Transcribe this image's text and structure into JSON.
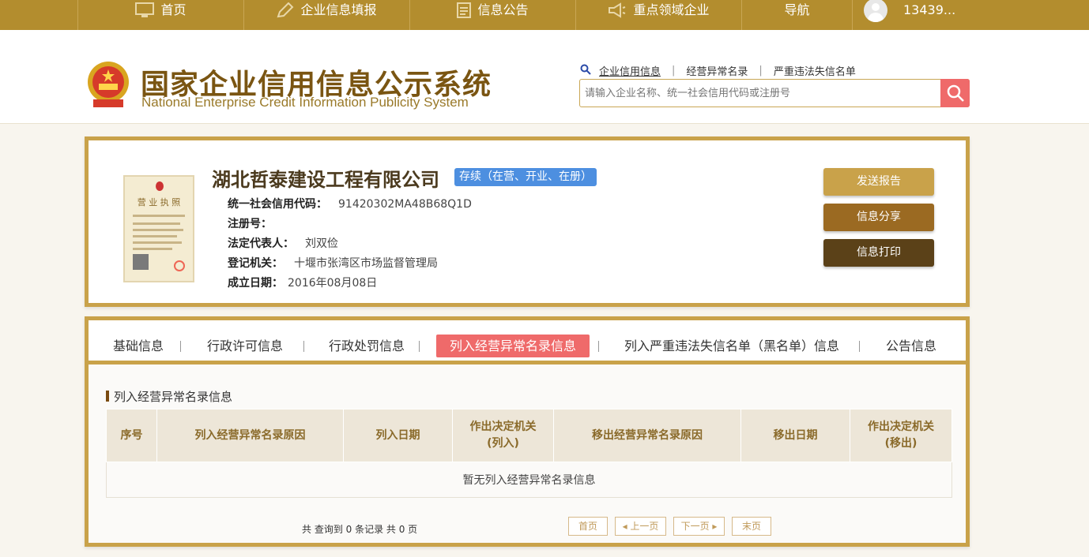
{
  "topnav": {
    "items": [
      {
        "label": "首页",
        "icon": "monitor-icon"
      },
      {
        "label": "企业信息填报",
        "icon": "edit-icon"
      },
      {
        "label": "信息公告",
        "icon": "document-icon"
      },
      {
        "label": "重点领域企业",
        "icon": "megaphone-icon"
      },
      {
        "label": "导航",
        "icon": ""
      }
    ],
    "user_name": "13439..."
  },
  "header": {
    "title_cn": "国家企业信用信息公示系统",
    "title_en": "National Enterprise Credit Information Publicity System",
    "quicklinks": [
      "企业信用信息",
      "经营异常名录",
      "严重违法失信名单"
    ],
    "search_placeholder": "请输入企业名称、统一社会信用代码或注册号"
  },
  "company": {
    "name": "湖北哲泰建设工程有限公司",
    "status": "存续（在营、开业、在册）",
    "license_title": "营 业 执 照",
    "fields": [
      {
        "label": "统一社会信用代码：",
        "value": "91420302MA48B68Q1D"
      },
      {
        "label": "注册号：",
        "value": ""
      },
      {
        "label": "法定代表人：",
        "value": "刘双俭"
      },
      {
        "label": "登记机关：",
        "value": "十堰市张湾区市场监督管理局"
      },
      {
        "label": "成立日期：",
        "value": "2016年08月08日"
      }
    ],
    "actions": [
      {
        "label": "发送报告",
        "color": "#c9a24a"
      },
      {
        "label": "信息分享",
        "color": "#9b6a22"
      },
      {
        "label": "信息打印",
        "color": "#5b4118"
      }
    ]
  },
  "tabs": [
    {
      "label": "基础信息",
      "active": false
    },
    {
      "label": "行政许可信息",
      "active": false
    },
    {
      "label": "行政处罚信息",
      "active": false
    },
    {
      "label": "列入经营异常名录信息",
      "active": true
    },
    {
      "label": "列入严重违法失信名单（黑名单）信息",
      "active": false
    },
    {
      "label": "公告信息",
      "active": false
    }
  ],
  "section": {
    "title": "列入经营异常名录信息",
    "columns": [
      "序号",
      "列入经营异常名录原因",
      "列入日期",
      "作出决定机关(列入)",
      "移出经营异常名录原因",
      "移出日期",
      "作出决定机关(移出)"
    ],
    "empty_text": "暂无列入经营异常名录信息"
  },
  "pager": {
    "info": "共 查询到 0 条记录 共 0 页",
    "first": "首页",
    "prev": "◂ 上一页",
    "next": "下一页 ▸",
    "last": "末页"
  }
}
